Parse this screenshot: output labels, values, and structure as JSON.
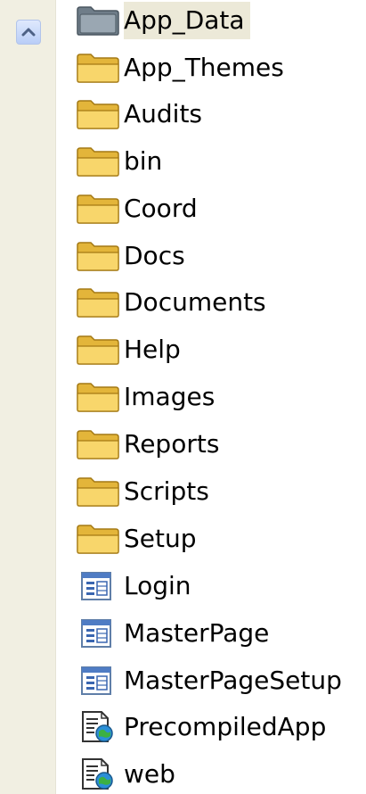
{
  "items": [
    {
      "label": "App_Data",
      "icon": "folder-gray-icon"
    },
    {
      "label": "App_Themes",
      "icon": "folder-icon"
    },
    {
      "label": "Audits",
      "icon": "folder-icon"
    },
    {
      "label": "bin",
      "icon": "folder-icon"
    },
    {
      "label": "Coord",
      "icon": "folder-icon"
    },
    {
      "label": "Docs",
      "icon": "folder-icon"
    },
    {
      "label": "Documents",
      "icon": "folder-icon"
    },
    {
      "label": "Help",
      "icon": "folder-icon"
    },
    {
      "label": "Images",
      "icon": "folder-icon"
    },
    {
      "label": "Reports",
      "icon": "folder-icon"
    },
    {
      "label": "Scripts",
      "icon": "folder-icon"
    },
    {
      "label": "Setup",
      "icon": "folder-icon"
    },
    {
      "label": "Login",
      "icon": "aspx-page-icon"
    },
    {
      "label": "MasterPage",
      "icon": "aspx-page-icon"
    },
    {
      "label": "MasterPageSetup",
      "icon": "aspx-page-icon"
    },
    {
      "label": "PrecompiledApp",
      "icon": "config-file-icon"
    },
    {
      "label": "web",
      "icon": "config-file-icon"
    }
  ],
  "colors": {
    "folder": "#f5d061",
    "folder_dark": "#c79a1e",
    "folder_gray": "#8c9aa6",
    "selected_bg": "#ece9d8"
  }
}
